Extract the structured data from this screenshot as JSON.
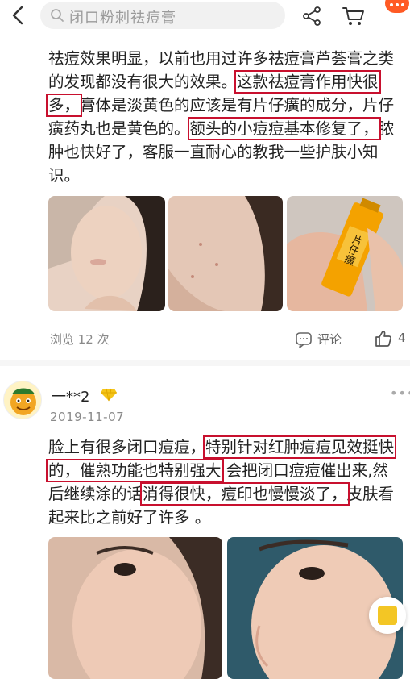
{
  "search": {
    "placeholder": "闭口粉刺祛痘膏"
  },
  "review1": {
    "lines": [
      [
        "祛痘效果明显，以前也用过许多祛痘膏芦荟膏之类",
        "",
        ""
      ],
      [
        "的发现都没有很大的效果。",
        "这款祛痘膏作用快很",
        ""
      ],
      [
        "",
        "多，",
        "膏体是淡黄色的应该是有片仔癀的成分，片仔"
      ],
      [
        "癀药丸也是黄色的。",
        "额头的小痘痘基本修复了，",
        "脓"
      ],
      [
        "肿也快好了，客服一直耐心的教我一些护肤小知",
        "",
        ""
      ],
      [
        "识。",
        "",
        ""
      ]
    ],
    "views": "浏览 12 次",
    "comment_label": "评论",
    "likes": "4",
    "product_label": "片仔癀"
  },
  "review2": {
    "user": "一**2",
    "date": "2019-11-07",
    "lines": [
      [
        "脸上有很多闭口痘痘，",
        "特别针对红肿痘痘见效挺快",
        ""
      ],
      [
        "",
        "的，催熟功能也特别强大",
        " 会把闭口痘痘催出来,然"
      ],
      [
        "后继续涂的话",
        "消得很快，痘印也慢慢淡了，",
        "皮肤看"
      ],
      [
        "起来比之前好了许多 。",
        "",
        ""
      ]
    ]
  },
  "colors": {
    "highlight": "#c8102e",
    "accent": "#ff5a24"
  },
  "icons": [
    "back-arrow-icon",
    "search-icon",
    "share-icon",
    "cart-icon",
    "more-icon",
    "comment-icon",
    "thumbs-up-icon",
    "vip-diamond-icon",
    "float-action-icon"
  ]
}
